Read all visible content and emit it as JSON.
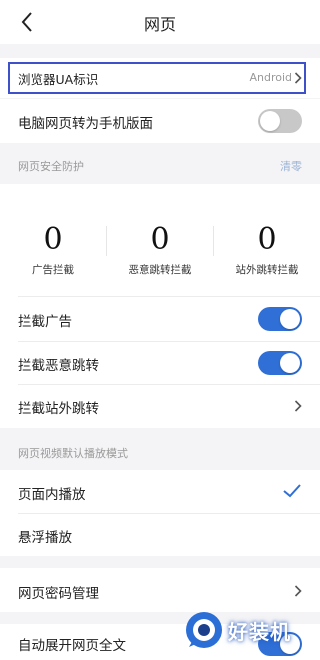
{
  "header": {
    "title": "网页"
  },
  "ua_row": {
    "label": "浏览器UA标识",
    "value": "Android"
  },
  "desktop_row": {
    "label": "电脑网页转为手机版面",
    "enabled": false
  },
  "security": {
    "section_label": "网页安全防护",
    "clear_label": "清零",
    "stats": [
      {
        "value": "0",
        "label": "广告拦截"
      },
      {
        "value": "0",
        "label": "恶意跳转拦截"
      },
      {
        "value": "0",
        "label": "站外跳转拦截"
      }
    ],
    "block_ads": {
      "label": "拦截广告",
      "enabled": true
    },
    "block_malicious": {
      "label": "拦截恶意跳转",
      "enabled": true
    },
    "block_offsite": {
      "label": "拦截站外跳转"
    }
  },
  "video": {
    "section_label": "网页视频默认播放模式",
    "options": [
      {
        "label": "页面内播放",
        "selected": true
      },
      {
        "label": "悬浮播放",
        "selected": false
      }
    ]
  },
  "password_row": {
    "label": "网页密码管理"
  },
  "expand_row": {
    "label": "自动展开网页全文",
    "enabled": true
  },
  "watermark": {
    "text": "好装机"
  },
  "colors": {
    "accent": "#2f6fd6",
    "highlight_border": "#3f51c8",
    "toggle_off": "#c8c8c8"
  },
  "icons": [
    "back-arrow-icon",
    "chevron-right-icon",
    "checkmark-icon",
    "watermark-logo-icon"
  ]
}
